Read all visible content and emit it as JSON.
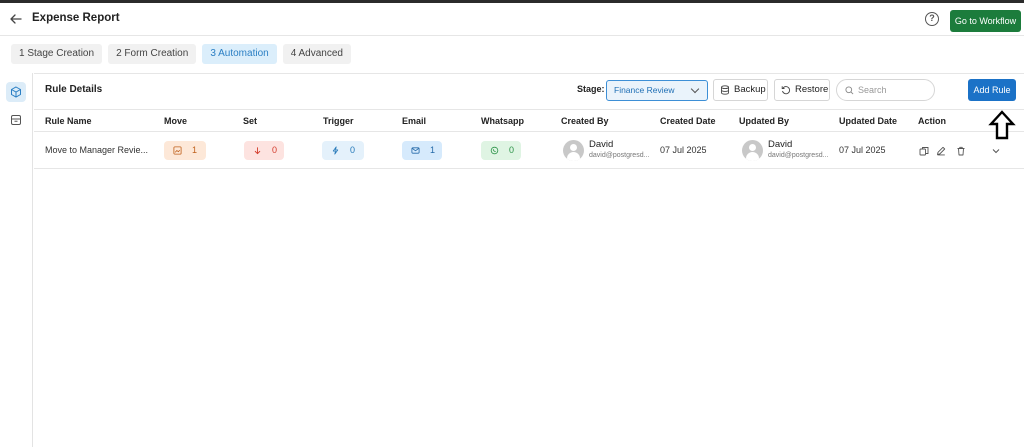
{
  "header": {
    "title": "Expense Report",
    "help_icon": "help-circle-icon",
    "workflow_button": "Go to Workflow"
  },
  "steps": [
    {
      "label": "1 Stage Creation",
      "active": false
    },
    {
      "label": "2 Form Creation",
      "active": false
    },
    {
      "label": "3 Automation",
      "active": true
    },
    {
      "label": "4 Advanced",
      "active": false
    }
  ],
  "panel": {
    "title": "Rule Details",
    "stage_label": "Stage:",
    "stage_value": "Finance Review",
    "backup_label": "Backup",
    "restore_label": "Restore",
    "search_placeholder": "Search",
    "add_rule_label": "Add Rule"
  },
  "table": {
    "columns": [
      "Rule Name",
      "Move",
      "Set",
      "Trigger",
      "Email",
      "Whatsapp",
      "Created By",
      "Created Date",
      "Updated By",
      "Updated Date",
      "Action"
    ],
    "rows": [
      {
        "rule_name": "Move to Manager Revie...",
        "move": "1",
        "set": "0",
        "trigger": "0",
        "email": "1",
        "whatsapp": "0",
        "created_by": {
          "name": "David",
          "email": "david@postgresd..."
        },
        "created_date": "07 Jul 2025",
        "updated_by": {
          "name": "David",
          "email": "david@postgresd..."
        },
        "updated_date": "07 Jul 2025"
      }
    ]
  },
  "colors": {
    "primary": "#1b72c7",
    "workflow_green": "#1c7c3c",
    "active_step_bg": "#dbeefb",
    "active_step_text": "#2b7fc4"
  }
}
